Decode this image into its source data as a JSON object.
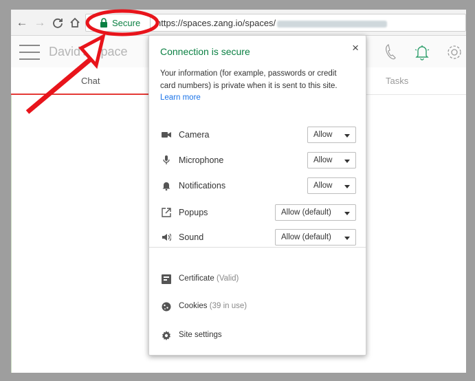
{
  "browser": {
    "secure_label": "Secure",
    "url": "https://spaces.zang.io/spaces/"
  },
  "app": {
    "space_title": "David's Space",
    "tabs": [
      {
        "label": "Chat",
        "active": true
      },
      {
        "label": "Tasks",
        "active": false
      }
    ],
    "accent_color": "#e53935"
  },
  "popup": {
    "title": "Connection is secure",
    "description": "Your information (for example, passwords or credit card numbers) is private when it is sent to this site.",
    "learn_more": "Learn more",
    "close_glyph": "×",
    "permissions": [
      {
        "icon": "camera-icon",
        "label": "Camera",
        "value": "Allow"
      },
      {
        "icon": "microphone-icon",
        "label": "Microphone",
        "value": "Allow"
      },
      {
        "icon": "notifications-icon",
        "label": "Notifications",
        "value": "Allow"
      },
      {
        "icon": "popups-icon",
        "label": "Popups",
        "value": "Allow (default)"
      },
      {
        "icon": "sound-icon",
        "label": "Sound",
        "value": "Allow (default)"
      }
    ],
    "certificate": {
      "label": "Certificate",
      "status": "(Valid)"
    },
    "cookies": {
      "label": "Cookies",
      "status": "(39 in use)"
    },
    "site_settings": {
      "label": "Site settings"
    }
  },
  "colors": {
    "secure_green": "#0b8043",
    "link_blue": "#1a73e8",
    "annotation_red": "#e8141b"
  }
}
